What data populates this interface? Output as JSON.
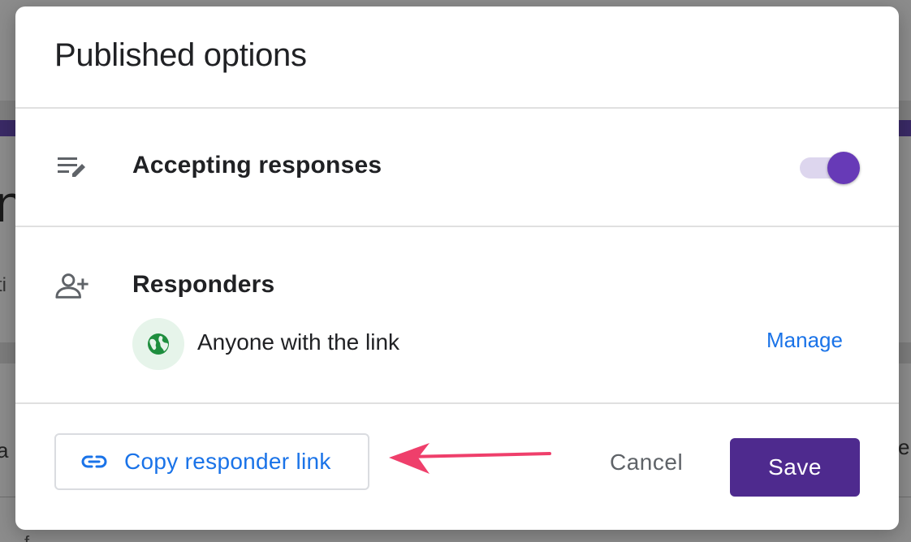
{
  "dialog": {
    "title": "Published options"
  },
  "accepting": {
    "label": "Accepting responses",
    "icon": "list-edit-icon",
    "enabled": true,
    "accent_color": "#673ab7"
  },
  "responders": {
    "label": "Responders",
    "icon": "person-add-icon",
    "access": {
      "icon": "globe-icon",
      "text": "Anyone with the link"
    },
    "manage_label": "Manage"
  },
  "footer": {
    "copy_label": "Copy responder link",
    "copy_icon": "link-icon",
    "cancel_label": "Cancel",
    "save_label": "Save",
    "save_color": "#4e2a8e"
  },
  "annotation": {
    "arrow_color": "#ef3f6b"
  }
}
